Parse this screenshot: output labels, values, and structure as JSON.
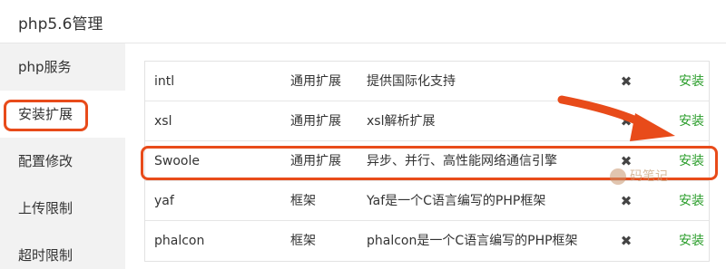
{
  "header": {
    "title": "php5.6管理"
  },
  "sidebar": {
    "items": [
      {
        "label": "php服务"
      },
      {
        "label": "安装扩展"
      },
      {
        "label": "配置修改"
      },
      {
        "label": "上传限制"
      },
      {
        "label": "超时限制"
      }
    ]
  },
  "extensions": [
    {
      "name": "intl",
      "type": "通用扩展",
      "desc": "提供国际化支持",
      "status": "✖",
      "action": "安装"
    },
    {
      "name": "xsl",
      "type": "通用扩展",
      "desc": "xsl解析扩展",
      "status": "✖",
      "action": "安装"
    },
    {
      "name": "Swoole",
      "type": "通用扩展",
      "desc": "异步、并行、高性能网络通信引擎",
      "status": "✖",
      "action": "安装"
    },
    {
      "name": "yaf",
      "type": "框架",
      "desc": "Yaf是一个C语言编写的PHP框架",
      "status": "✖",
      "action": "安装"
    },
    {
      "name": "phalcon",
      "type": "框架",
      "desc": "phalcon是一个C语言编写的PHP框架",
      "status": "✖",
      "action": "安装"
    }
  ],
  "watermark": {
    "text": "码笔记"
  },
  "colors": {
    "accent": "#e84b1a",
    "install": "#2a9d2a"
  }
}
